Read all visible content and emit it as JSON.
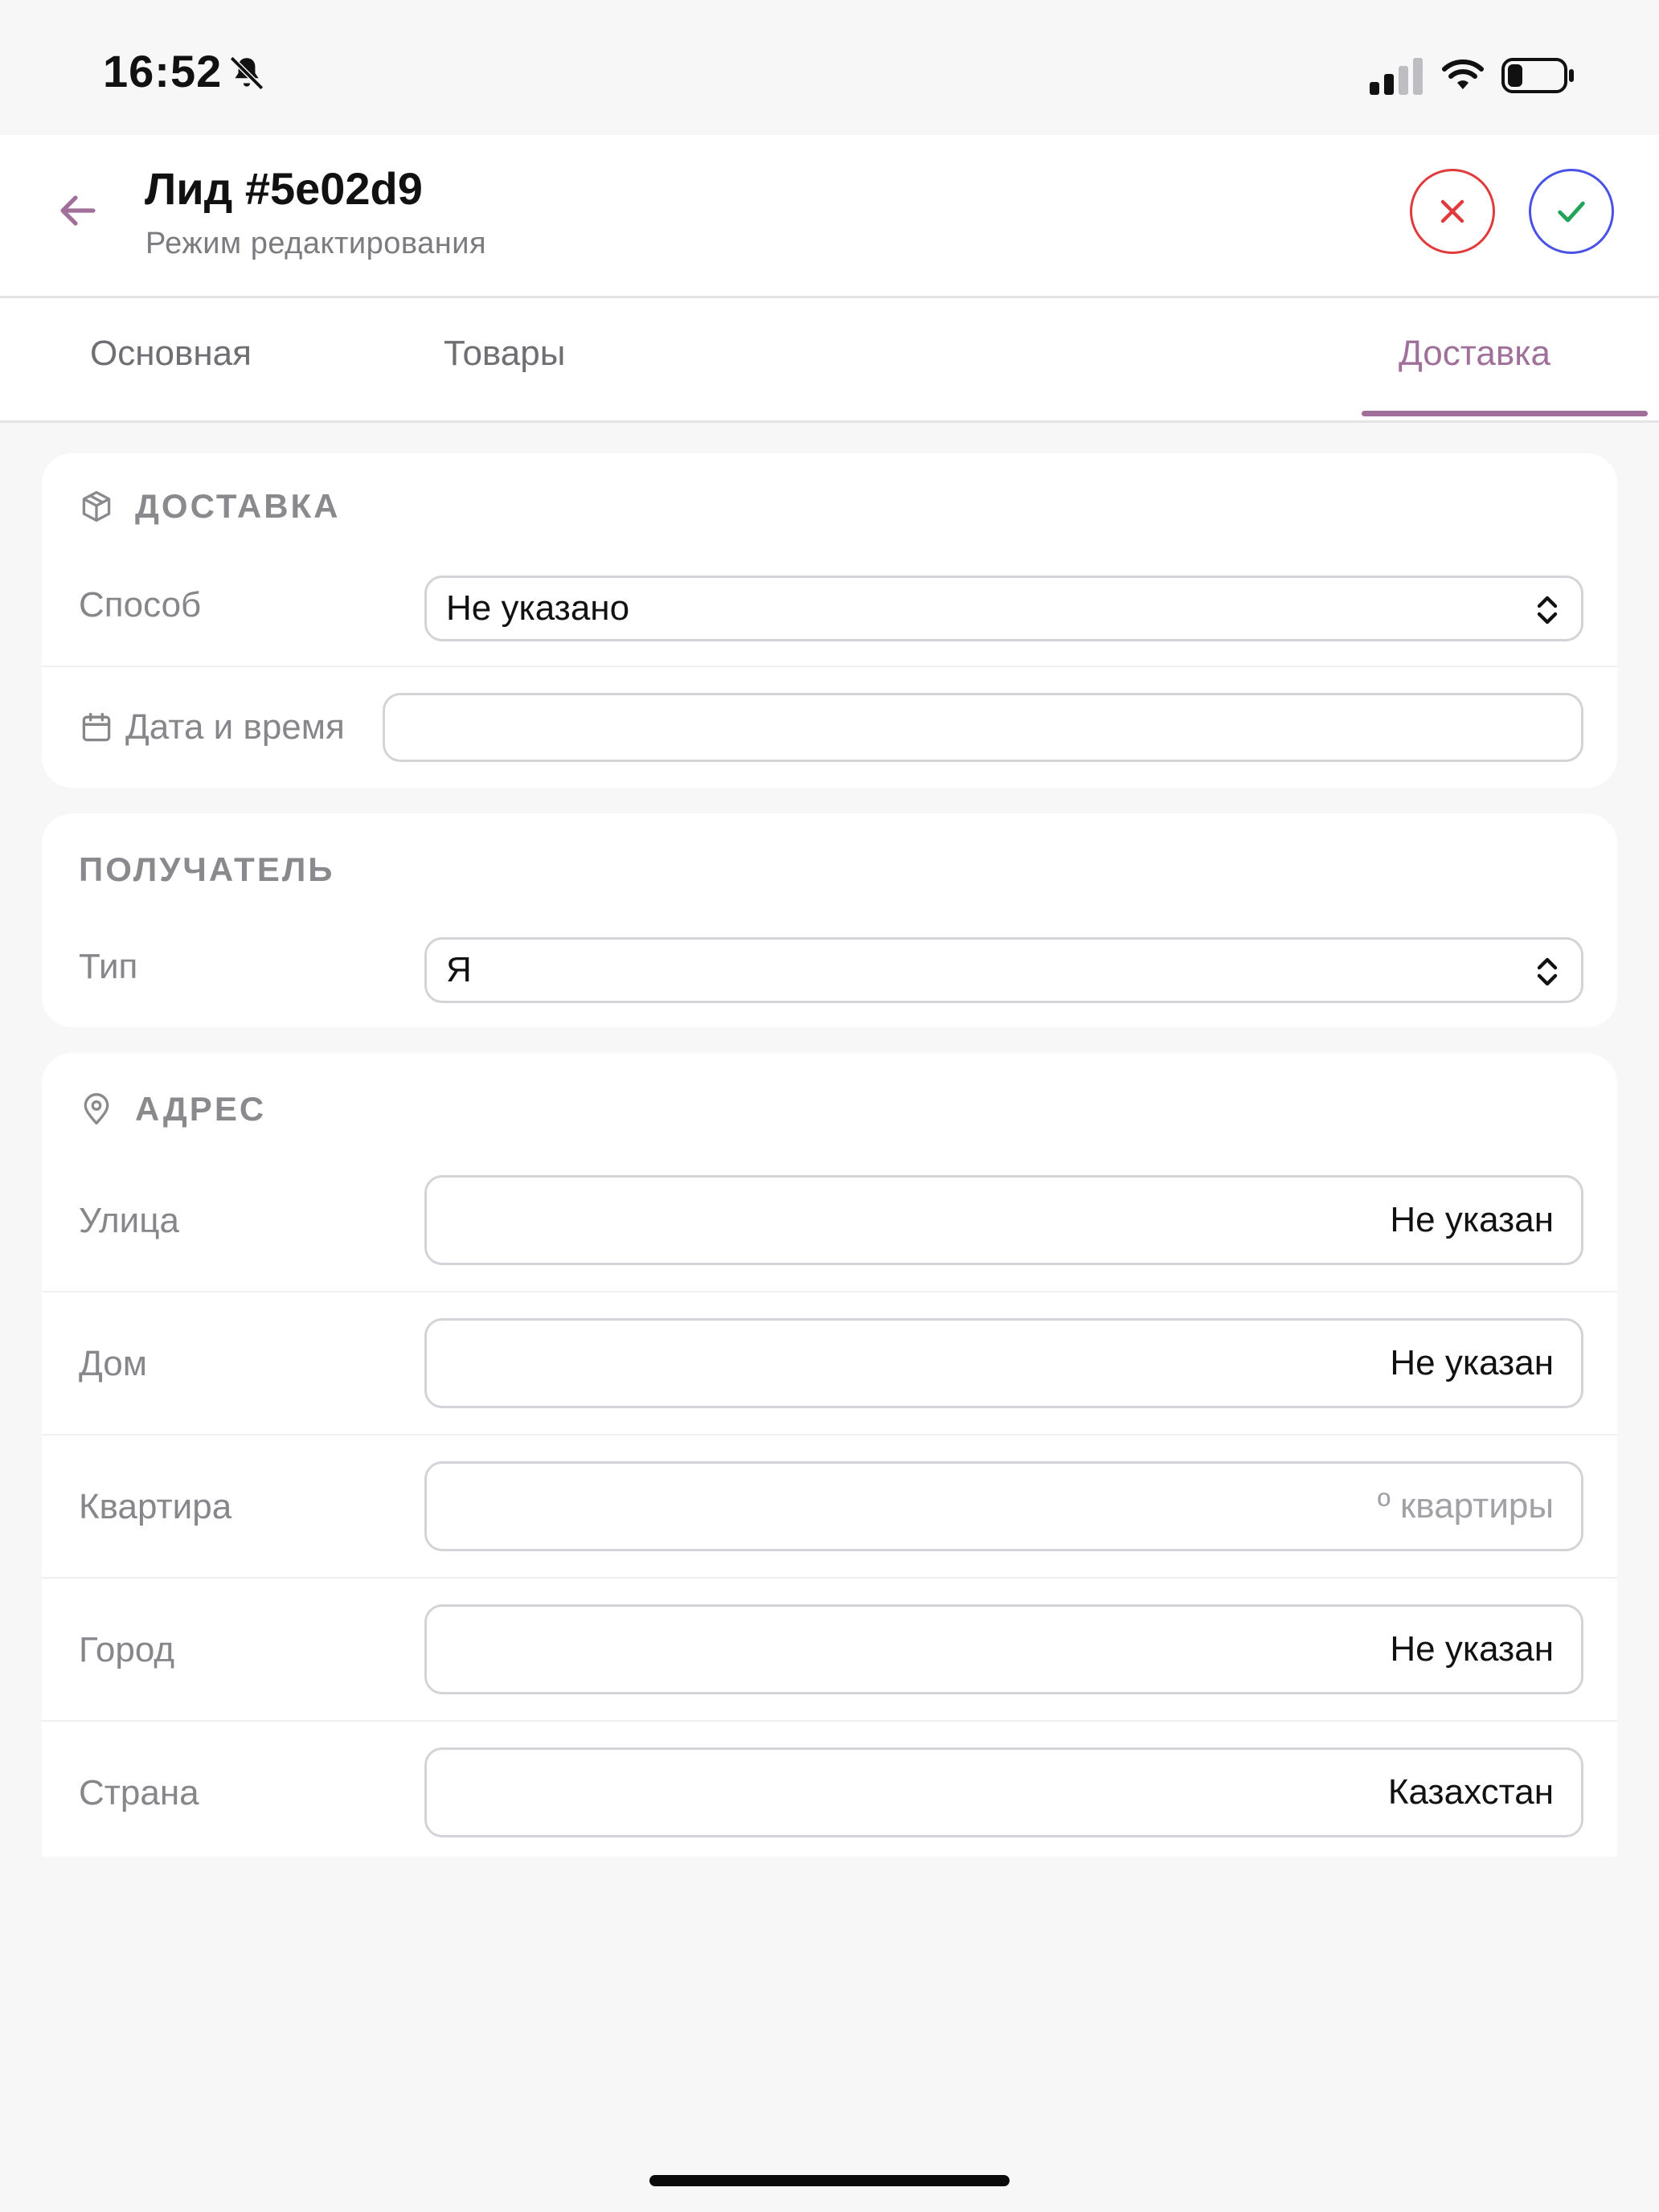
{
  "status_bar": {
    "time": "16:52"
  },
  "header": {
    "title": "Лид #5e02d9",
    "subtitle": "Режим редактирования"
  },
  "tabs": [
    {
      "label": "Основная"
    },
    {
      "label": "Товары"
    },
    {
      "label": "Доставка",
      "active": true
    }
  ],
  "delivery": {
    "title": "ДОСТАВКА",
    "method_label": "Способ",
    "method_value": "Не указано",
    "datetime_label": "Дата и время",
    "datetime_value": ""
  },
  "recipient": {
    "title": "ПОЛУЧАТЕЛЬ",
    "type_label": "Тип",
    "type_value": "Я"
  },
  "address": {
    "title": "АДРЕС",
    "fields": [
      {
        "label": "Улица",
        "value": "Не указан"
      },
      {
        "label": "Дом",
        "value": "Не указан"
      },
      {
        "label": "Квартира",
        "placeholder": "º квартиры"
      },
      {
        "label": "Город",
        "value": "Не указан"
      },
      {
        "label": "Страна",
        "value": "Казахстан"
      }
    ]
  },
  "colors": {
    "accent": "#a0709a",
    "cancel": "#e03a3a",
    "confirm_border": "#4a52e6",
    "confirm_check": "#22a35a"
  }
}
